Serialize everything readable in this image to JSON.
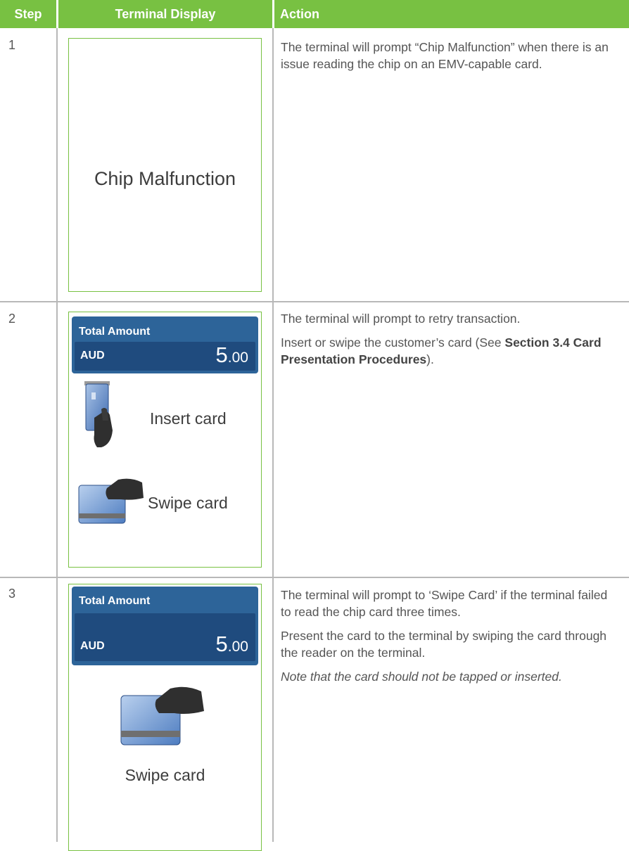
{
  "header": {
    "step": "Step",
    "display": "Terminal Display",
    "action": "Action"
  },
  "rows": [
    {
      "step": "1",
      "screen_text": "Chip Malfunction",
      "action_p1": "The terminal will prompt “Chip Malfunction” when there is an issue reading the chip on an EMV-capable card."
    },
    {
      "step": "2",
      "amount_title": "Total Amount",
      "currency": "AUD",
      "amount_main": "5",
      "amount_dec": ".00",
      "insert_label": "Insert card",
      "swipe_label": "Swipe card",
      "action_p1": "The terminal will prompt to retry transaction.",
      "action_p2_pre": "Insert or swipe the customer’s card (See ",
      "action_p2_bold": "Section 3.4 Card Presentation Procedures",
      "action_p2_post": ")."
    },
    {
      "step": "3",
      "amount_title": "Total Amount",
      "currency": "AUD",
      "amount_main": "5",
      "amount_dec": ".00",
      "swipe_label": "Swipe card",
      "action_p1": "The terminal will prompt to ‘Swipe Card’ if the terminal failed to read the chip card three times.",
      "action_p2": "Present the card to the terminal by swiping the card through the reader on the terminal.",
      "action_p3": "Note that the card should not be tapped or inserted."
    }
  ],
  "colors": {
    "header_green": "#78c142",
    "screen_blue": "#2d6499",
    "screen_dark_blue": "#1f4b7e",
    "grid": "#b8b8b8"
  },
  "icons": [
    "card-insert-icon",
    "card-swipe-icon"
  ]
}
